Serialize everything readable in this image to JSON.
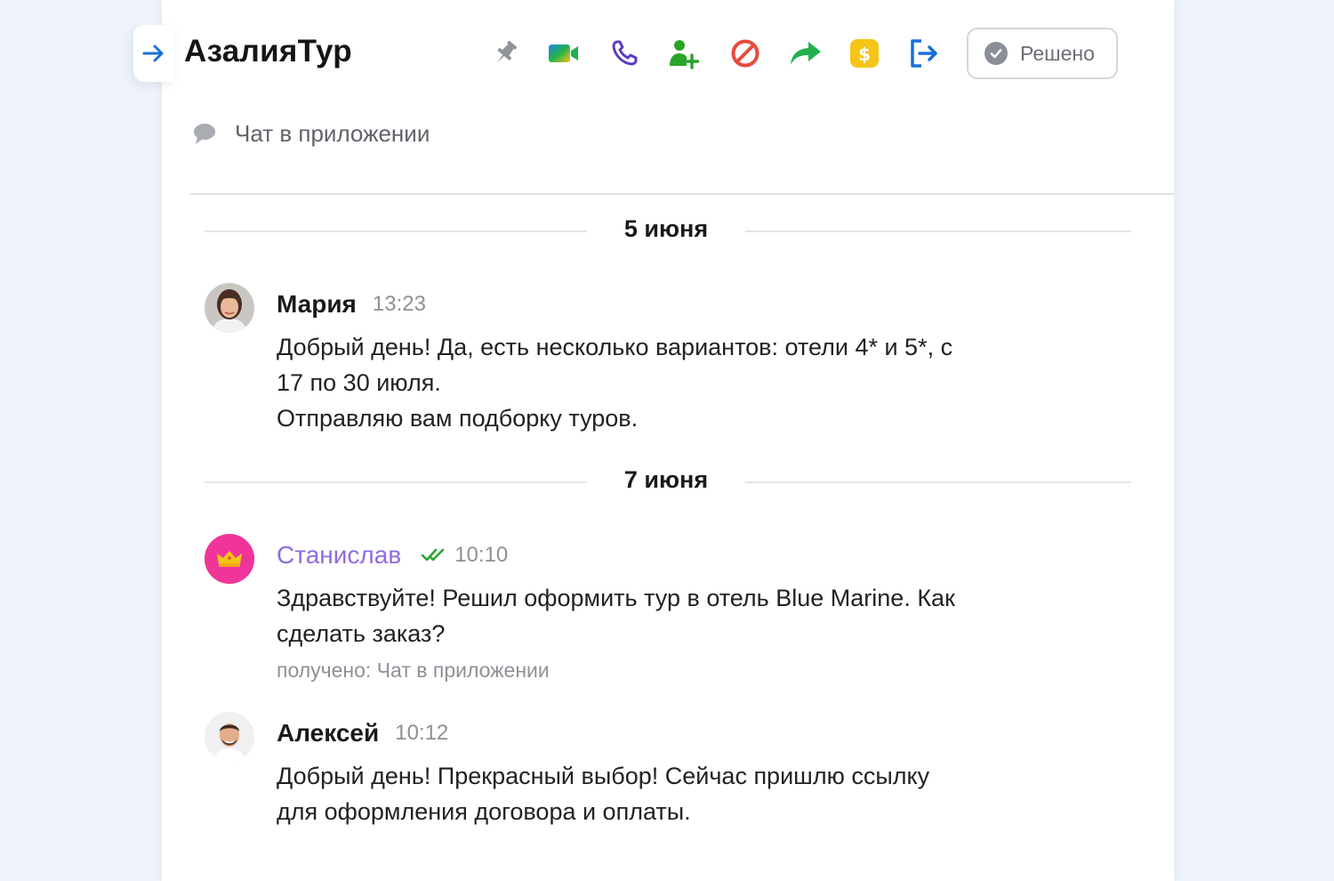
{
  "header": {
    "title": "АзалияТур",
    "resolve_label": "Решено",
    "channel_label": "Чат в приложении",
    "toolbar": [
      {
        "name": "pin-icon",
        "color": "#8f949b"
      },
      {
        "name": "video-call-icon",
        "color": "#22b14c"
      },
      {
        "name": "phone-icon",
        "color": "#5b3cc4"
      },
      {
        "name": "add-user-icon",
        "color": "#2aa52a"
      },
      {
        "name": "block-icon",
        "color": "#e74c3c"
      },
      {
        "name": "forward-icon",
        "color": "#22b14c"
      },
      {
        "name": "payment-icon",
        "color": "#f5c518"
      },
      {
        "name": "exit-icon",
        "color": "#1a6fd8"
      }
    ]
  },
  "timeline": {
    "dates": [
      "5 июня",
      "7 июня"
    ],
    "messages": [
      {
        "author": "Мария",
        "time": "13:23",
        "lines": [
          "Добрый день! Да, есть несколько вариантов: отели 4* и 5*, с",
          "17 по 30 июля.",
          "Отправляю вам подборку туров."
        ]
      },
      {
        "author": "Станислав",
        "time": "10:10",
        "lines": [
          "Здравствуйте! Решил оформить тур в отель Blue Marine. Как",
          "сделать заказ?"
        ],
        "received": "получено: Чат в приложении"
      },
      {
        "author": "Алексей",
        "time": "10:12",
        "lines": [
          "Добрый день! Прекрасный выбор! Сейчас пришлю ссылку",
          "для оформления договора и оплаты."
        ]
      }
    ]
  },
  "colors": {
    "accent": "#1a6fd8",
    "client_name": "#8e6ce0",
    "client_avatar": "#f0359a",
    "read_check": "#2aa52a"
  }
}
